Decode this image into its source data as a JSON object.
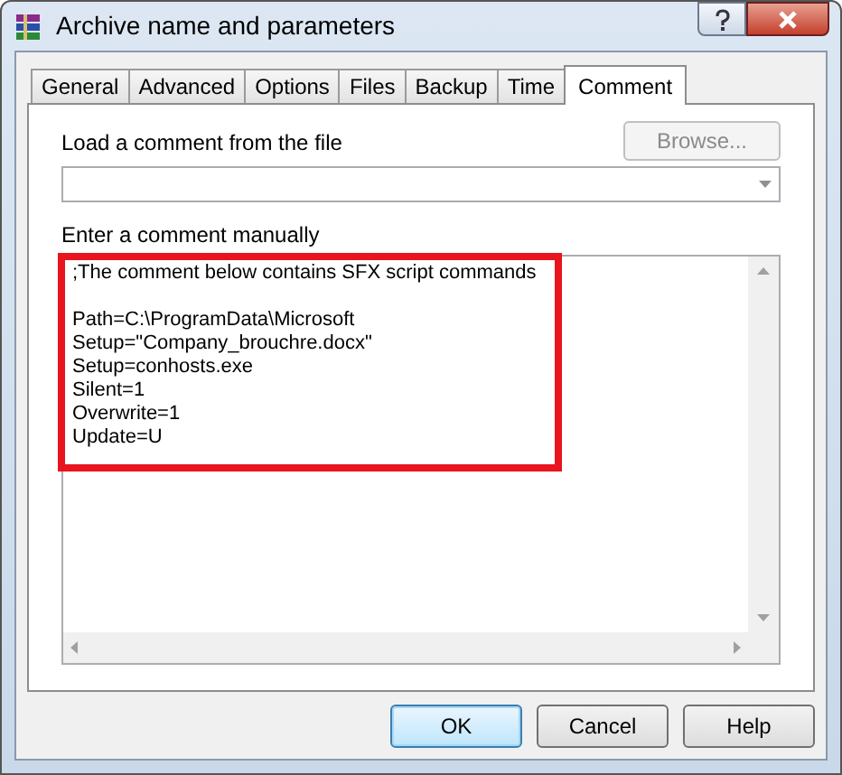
{
  "window": {
    "title": "Archive name and parameters"
  },
  "tabs": [
    {
      "label": "General",
      "selected": false
    },
    {
      "label": "Advanced",
      "selected": false
    },
    {
      "label": "Options",
      "selected": false
    },
    {
      "label": "Files",
      "selected": false
    },
    {
      "label": "Backup",
      "selected": false
    },
    {
      "label": "Time",
      "selected": false
    },
    {
      "label": "Comment",
      "selected": true
    }
  ],
  "load_label": "Load a comment from the file",
  "browse_button": {
    "label": "Browse...",
    "disabled": true
  },
  "comment_label": "Enter a comment manually",
  "comment_blocks": [
    [
      ";The comment below contains SFX script commands"
    ],
    [
      "Path=C:\\ProgramData\\Microsoft",
      "Setup=\"Company_brouchre.docx\"",
      "Setup=conhosts.exe",
      "Silent=1",
      "Overwrite=1",
      "Update=U"
    ]
  ],
  "highlight": true,
  "buttons": [
    {
      "label": "OK",
      "selected": true
    },
    {
      "label": "Cancel",
      "selected": false
    },
    {
      "label": "Help",
      "selected": false
    }
  ]
}
